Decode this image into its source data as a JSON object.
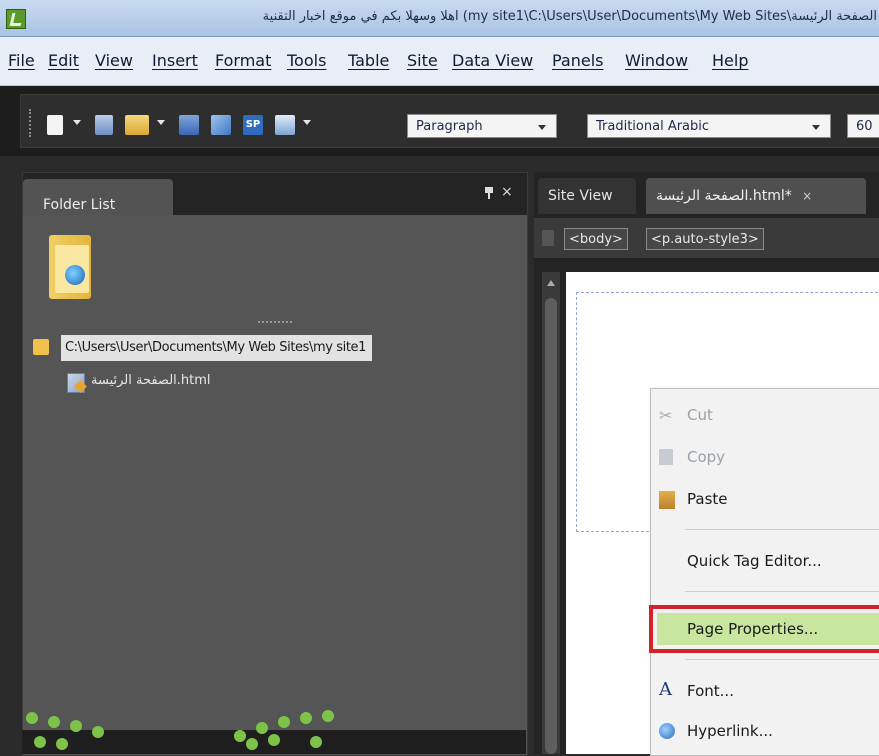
{
  "window": {
    "title": "الصفحة الرئيسة\\my site1\\C:\\Users\\User\\Documents\\My Web Sites) اهلا وسهلا بكم في موقع اخبار التقنية"
  },
  "menubar": {
    "items": [
      "File",
      "Edit",
      "View",
      "Insert",
      "Format",
      "Tools",
      "Table",
      "Site",
      "Data View",
      "Panels",
      "Window",
      "Help"
    ]
  },
  "toolbar": {
    "style_select": "Paragraph",
    "font_select": "Traditional Arabic",
    "size_select": "60",
    "icons": [
      "new-page-icon",
      "page-icon",
      "open-folder-icon",
      "save-icon",
      "globe-icon",
      "sharepoint-icon",
      "preview-icon"
    ]
  },
  "folder_list": {
    "title": "Folder List",
    "close_glyph": "×",
    "path": "C:\\Users\\User\\Documents\\My Web Sites\\my site1",
    "file": "الصفحة الرئيسة.html"
  },
  "editor": {
    "tabs": [
      {
        "label": "Site View"
      },
      {
        "label": "الصفحة الرئيسة.html*",
        "close": "×"
      }
    ],
    "tags": [
      "<body>",
      "<p.auto-style3>"
    ]
  },
  "context_menu": {
    "items": [
      {
        "label": "Cut",
        "enabled": false,
        "icon": "scissors-icon"
      },
      {
        "label": "Copy",
        "enabled": false,
        "icon": "copy-icon"
      },
      {
        "label": "Paste",
        "enabled": true,
        "icon": "clipboard-icon"
      },
      {
        "label": "Quick Tag Editor...",
        "enabled": true
      },
      {
        "label": "Page Properties...",
        "enabled": true,
        "highlighted": true
      },
      {
        "label": "Font...",
        "enabled": true,
        "icon": "font-icon",
        "icon_glyph": "A"
      },
      {
        "label": "Hyperlink...",
        "enabled": true,
        "icon": "hyperlink-icon"
      }
    ]
  },
  "colors": {
    "highlight_border": "#d2232a",
    "highlight_fill": "#c8e6a0",
    "dark_chrome": "#2b2b2b",
    "panel_gray": "#555555"
  }
}
